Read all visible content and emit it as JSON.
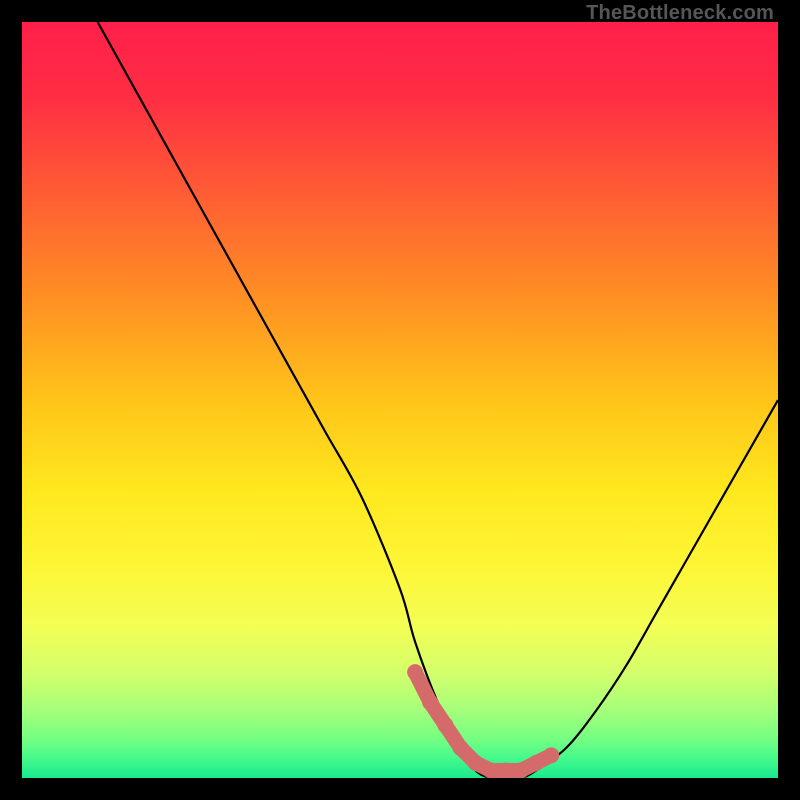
{
  "watermark": "TheBottleneck.com",
  "colors": {
    "frame": "#000000",
    "curve": "#000000",
    "marker": "#d46a6a",
    "gradient_stops": [
      {
        "pos": 0.0,
        "color": "#ff1f4a"
      },
      {
        "pos": 0.1,
        "color": "#ff2e44"
      },
      {
        "pos": 0.22,
        "color": "#ff5a35"
      },
      {
        "pos": 0.35,
        "color": "#ff8a25"
      },
      {
        "pos": 0.5,
        "color": "#ffc41a"
      },
      {
        "pos": 0.62,
        "color": "#ffe81e"
      },
      {
        "pos": 0.72,
        "color": "#fdf636"
      },
      {
        "pos": 0.8,
        "color": "#f3fe55"
      },
      {
        "pos": 0.86,
        "color": "#d4ff6b"
      },
      {
        "pos": 0.91,
        "color": "#a6ff7a"
      },
      {
        "pos": 0.95,
        "color": "#72ff83"
      },
      {
        "pos": 0.975,
        "color": "#43f98b"
      },
      {
        "pos": 1.0,
        "color": "#19e98e"
      }
    ]
  },
  "chart_data": {
    "type": "line",
    "title": "",
    "xlabel": "",
    "ylabel": "",
    "xlim": [
      0,
      100
    ],
    "ylim": [
      0,
      100
    ],
    "series": [
      {
        "name": "bottleneck-curve",
        "x": [
          10,
          15,
          20,
          25,
          30,
          35,
          40,
          45,
          50,
          52,
          55,
          58,
          60,
          62,
          64,
          66,
          68,
          72,
          76,
          80,
          84,
          88,
          92,
          96,
          100
        ],
        "y": [
          100,
          91,
          82,
          73,
          64,
          55,
          46,
          37,
          25,
          18,
          10,
          4,
          1,
          0,
          0,
          0,
          1,
          4,
          9,
          15,
          22,
          29,
          36,
          43,
          50
        ]
      }
    ],
    "markers": {
      "name": "highlight-segment",
      "x": [
        52,
        54,
        56,
        58,
        60,
        62,
        64,
        66,
        68,
        70
      ],
      "y": [
        14,
        10,
        7,
        4,
        2,
        1,
        1,
        1,
        2,
        3
      ]
    }
  }
}
